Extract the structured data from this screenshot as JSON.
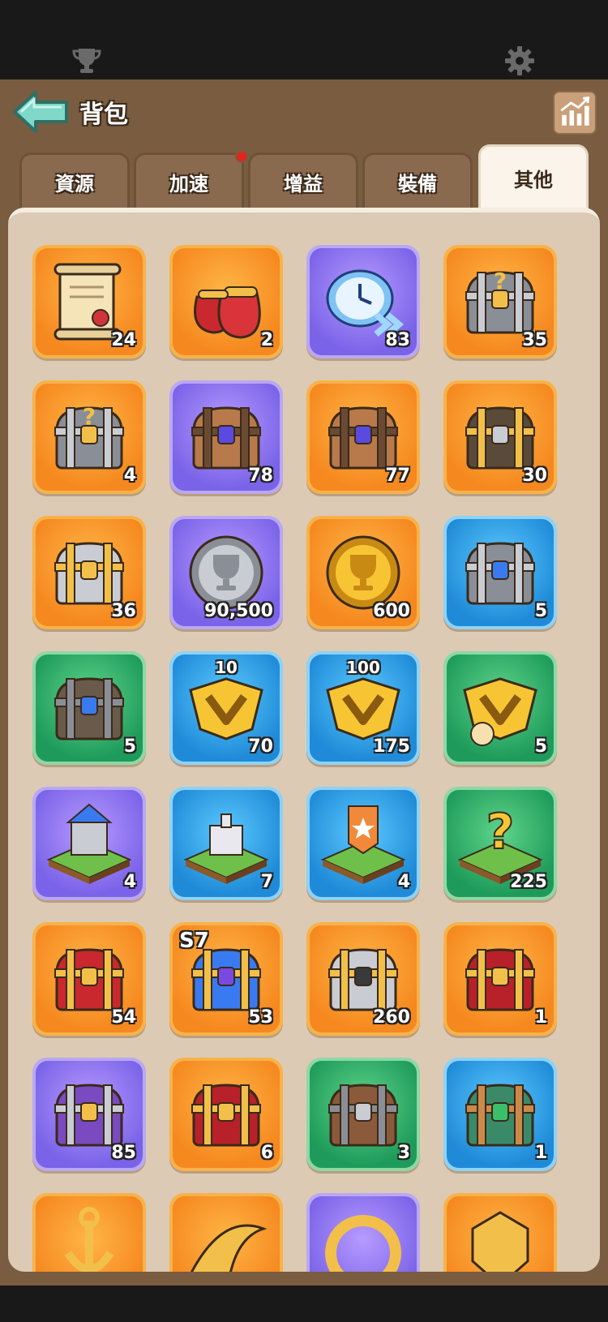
{
  "header": {
    "title": "背包"
  },
  "tabs": [
    {
      "label": "資源"
    },
    {
      "label": "加速"
    },
    {
      "label": "增益"
    },
    {
      "label": "裝備"
    },
    {
      "label": "其他"
    }
  ],
  "items": [
    {
      "count": "24",
      "color": "orange",
      "icon": "scroll-icon"
    },
    {
      "count": "2",
      "color": "orange",
      "icon": "red-bags-icon"
    },
    {
      "count": "83",
      "color": "purple",
      "icon": "speedup-clock-icon"
    },
    {
      "count": "35",
      "color": "orange",
      "icon": "mystery-gear-chest-icon"
    },
    {
      "count": "4",
      "color": "orange",
      "icon": "mystery-gem-chest-icon"
    },
    {
      "count": "78",
      "color": "purple",
      "icon": "bronze-gem-chest-icon"
    },
    {
      "count": "77",
      "color": "orange",
      "icon": "bronze-gem-chest-icon"
    },
    {
      "count": "30",
      "color": "orange",
      "icon": "gold-chest-icon"
    },
    {
      "count": "36",
      "color": "orange",
      "icon": "locked-gold-chest-icon"
    },
    {
      "count": "90,500",
      "color": "purple",
      "icon": "silver-trophy-coin-icon"
    },
    {
      "count": "600",
      "color": "orange",
      "icon": "gold-trophy-coin-icon"
    },
    {
      "count": "5",
      "color": "blue",
      "icon": "exp-chest-icon"
    },
    {
      "count": "5",
      "color": "green",
      "icon": "speedup-chest-icon"
    },
    {
      "count": "70",
      "color": "blue",
      "icon": "vip-badge-icon",
      "top": "10"
    },
    {
      "count": "175",
      "color": "blue",
      "icon": "vip-badge-icon",
      "top": "100"
    },
    {
      "count": "5",
      "color": "green",
      "icon": "vip-timer-badge-icon"
    },
    {
      "count": "4",
      "color": "purple",
      "icon": "castle-teleport-icon"
    },
    {
      "count": "7",
      "color": "blue",
      "icon": "fort-teleport-icon"
    },
    {
      "count": "4",
      "color": "blue",
      "icon": "banner-teleport-icon"
    },
    {
      "count": "225",
      "color": "green",
      "icon": "random-teleport-icon"
    },
    {
      "count": "54",
      "color": "orange",
      "icon": "season-chest-icon"
    },
    {
      "count": "53",
      "color": "orange",
      "icon": "s7-chest-icon",
      "badge": "S7"
    },
    {
      "count": "260",
      "color": "orange",
      "icon": "hero-chest-icon"
    },
    {
      "count": "1",
      "color": "orange",
      "icon": "red-gold-chest-icon"
    },
    {
      "count": "85",
      "color": "purple",
      "icon": "purple-puzzle-chest-icon"
    },
    {
      "count": "6",
      "color": "orange",
      "icon": "red-gold-chest-icon"
    },
    {
      "count": "3",
      "color": "green",
      "icon": "iron-chest-icon"
    },
    {
      "count": "1",
      "color": "blue",
      "icon": "green-gem-chest-icon"
    },
    {
      "count": "",
      "color": "orange",
      "icon": "anchor-icon"
    },
    {
      "count": "",
      "color": "orange",
      "icon": "horn-icon"
    },
    {
      "count": "",
      "color": "purple",
      "icon": "gold-ring-icon"
    },
    {
      "count": "",
      "color": "orange",
      "icon": "golden-crest-icon"
    }
  ],
  "icons": {
    "top_left": "trophy-icon",
    "top_right": "gear-icon",
    "back": "back-arrow-icon",
    "stats": "stats-chart-icon"
  }
}
